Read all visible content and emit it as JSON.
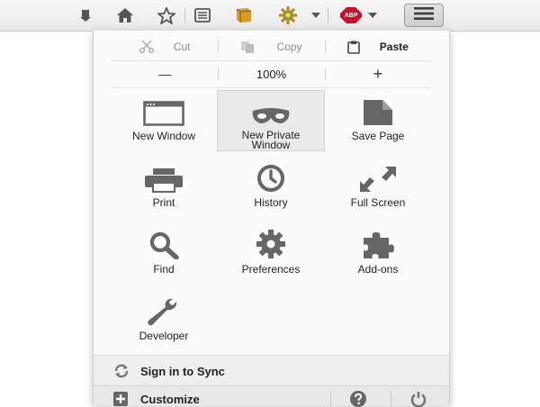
{
  "toolbar": {
    "abp_label": "ABP"
  },
  "menu": {
    "edit": {
      "cut": "Cut",
      "copy": "Copy",
      "paste": "Paste"
    },
    "zoom": {
      "out": "—",
      "level": "100%",
      "in": "+"
    },
    "items": [
      {
        "label": "New Window",
        "icon": "new-window-icon"
      },
      {
        "label": "New Private Window",
        "icon": "private-mask-icon"
      },
      {
        "label": "Save Page",
        "icon": "save-page-icon"
      },
      {
        "label": "Print",
        "icon": "printer-icon"
      },
      {
        "label": "History",
        "icon": "clock-icon"
      },
      {
        "label": "Full Screen",
        "icon": "fullscreen-icon"
      },
      {
        "label": "Find",
        "icon": "magnifier-icon"
      },
      {
        "label": "Preferences",
        "icon": "gear-icon"
      },
      {
        "label": "Add-ons",
        "icon": "puzzle-icon"
      },
      {
        "label": "Developer",
        "icon": "wrench-icon"
      }
    ],
    "footer": {
      "sync": "Sign in to Sync",
      "customize": "Customize"
    }
  },
  "colors": {
    "icon_gray": "#6e6e6e",
    "abp_red": "#c8102e",
    "highlight": "#eaeaea"
  }
}
